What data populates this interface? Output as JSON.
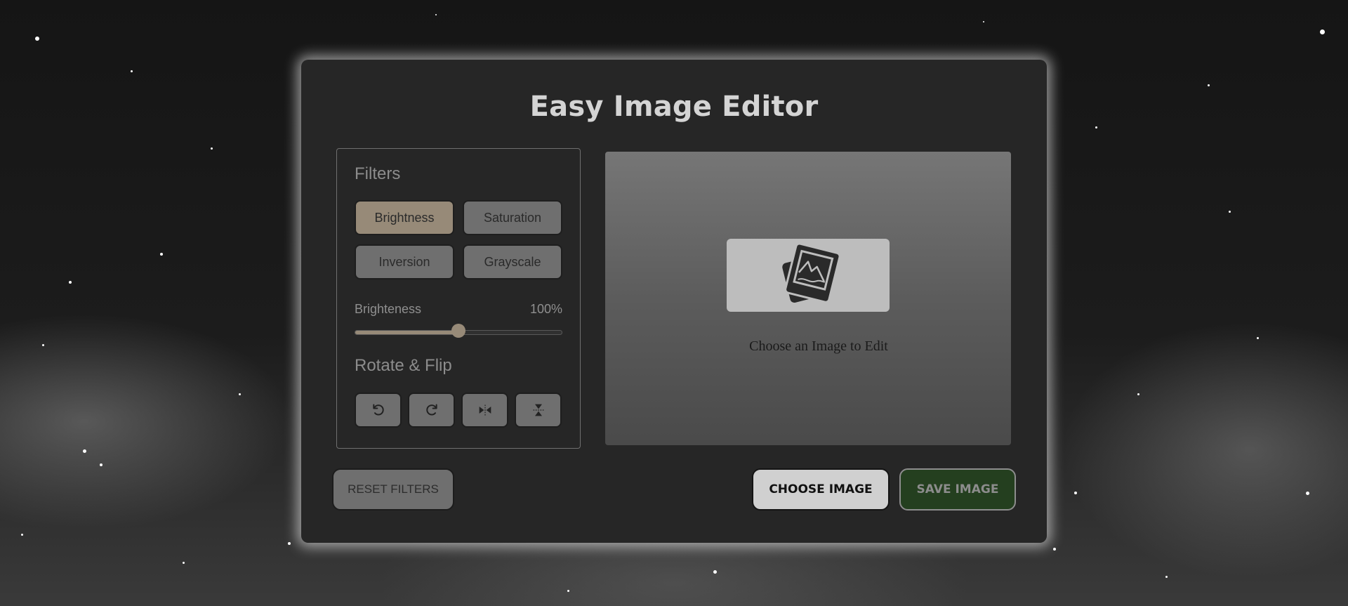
{
  "app": {
    "title": "Easy Image Editor"
  },
  "filters": {
    "heading": "Filters",
    "options": [
      {
        "label": "Brightness",
        "active": true
      },
      {
        "label": "Saturation",
        "active": false
      },
      {
        "label": "Inversion",
        "active": false
      },
      {
        "label": "Grayscale",
        "active": false
      }
    ]
  },
  "slider": {
    "label": "Brighteness",
    "value_text": "100%",
    "level_fraction": 0.5
  },
  "rotate_flip": {
    "heading": "Rotate & Flip",
    "icons": [
      "rotate-left-icon",
      "rotate-right-icon",
      "flip-horizontal-icon",
      "flip-vertical-icon"
    ]
  },
  "preview": {
    "placeholder_text": "Choose an Image to Edit",
    "icon": "image-placeholder-icon"
  },
  "actions": {
    "reset_label": "RESET FILTERS",
    "choose_label": "CHOOSE IMAGE",
    "save_label": "SAVE IMAGE"
  },
  "colors": {
    "accent": "#978a78",
    "panel_bg": "#262626",
    "save_bg": "#243f1f",
    "button_bg": "#6f6f6f"
  }
}
